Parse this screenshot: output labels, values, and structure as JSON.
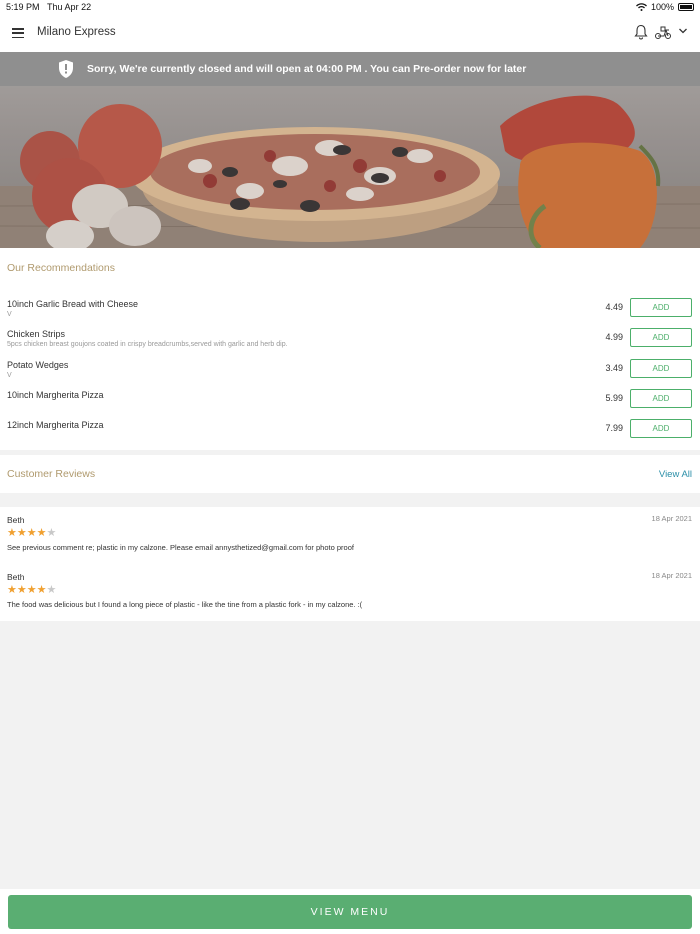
{
  "status_bar": {
    "time": "5:19 PM",
    "date": "Thu Apr 22",
    "battery": "100%"
  },
  "app_bar": {
    "title": "Milano Express"
  },
  "banner": {
    "message": "Sorry, We're currently closed and will open at 04:00 PM . You can Pre-order now for later"
  },
  "recommendations": {
    "title": "Our Recommendations",
    "add_label": "ADD",
    "items": [
      {
        "name": "10inch Garlic Bread with Cheese",
        "desc": "V",
        "price": "4.49"
      },
      {
        "name": "Chicken Strips",
        "desc": "5pcs chicken breast goujons coated in crispy breadcrumbs,served with garlic and herb dip.",
        "price": "4.99"
      },
      {
        "name": "Potato Wedges",
        "desc": "V",
        "price": "3.49"
      },
      {
        "name": "10inch Margherita Pizza",
        "desc": "",
        "price": "5.99"
      },
      {
        "name": "12inch Margherita Pizza",
        "desc": "",
        "price": "7.99"
      }
    ]
  },
  "reviews": {
    "title": "Customer Reviews",
    "view_all": "View All",
    "items": [
      {
        "name": "Beth",
        "date": "18 Apr 2021",
        "rating": 4,
        "text": "See previous comment re; plastic in my calzone. Please email annysthetized@gmail.com for photo proof"
      },
      {
        "name": "Beth",
        "date": "18 Apr 2021",
        "rating": 4,
        "text": "The food was delicious but I found a long piece of plastic - like the tine from a plastic fork - in my calzone. :("
      }
    ]
  },
  "bottom": {
    "view_menu": "VIEW MENU"
  },
  "colors": {
    "accent_green": "#5aae72",
    "section_title": "#b09a6e",
    "link": "#2b8fa8",
    "star": "#f0a030"
  }
}
